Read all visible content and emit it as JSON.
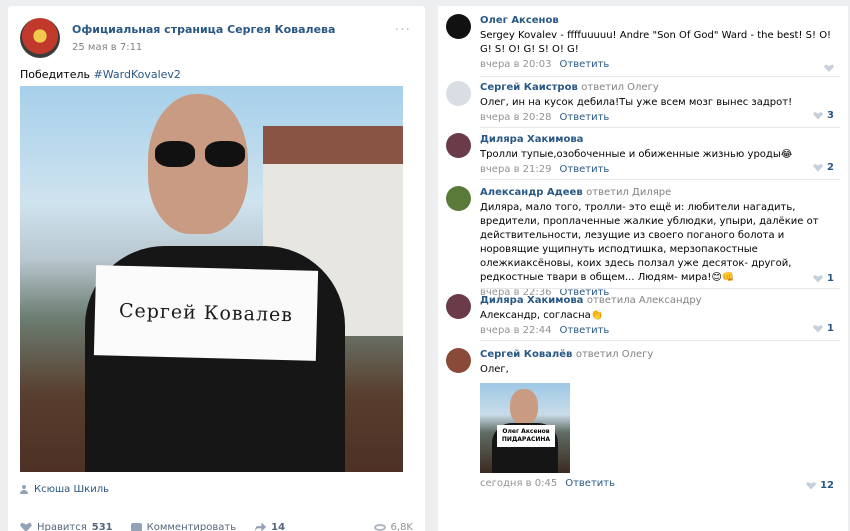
{
  "post": {
    "page_name": "Официальная страница Сергея Ковалева",
    "date": "25 мая в 7:11",
    "text_prefix": "Победитель ",
    "hashtag": "#WardKovalev2",
    "photo_sign": "Сергей Ковалев",
    "author": "Ксюша Шкиль",
    "actions": {
      "like_label": "Нравится",
      "like_count": "531",
      "comment_label": "Комментировать",
      "share_count": "14",
      "views": "6,8K"
    }
  },
  "comments": [
    {
      "author": "Олег Аксенов",
      "reply_to": "",
      "text": "Sergey Kovalev - ffffuuuuu! Andre \"Son Of God\" Ward - the best! S! O! G! S! O! G! S! O! G!",
      "time": "вчера в 20:03",
      "reply_label": "Ответить",
      "likes": "",
      "avatar_color": "#111111"
    },
    {
      "author": "Сергей Каистров",
      "reply_to": "ответил Олегу",
      "text": "Олег, ин на кусок дебила!Ты уже всем мозг вынес задрот!",
      "time": "вчера в 20:28",
      "reply_label": "Ответить",
      "likes": "3",
      "avatar_color": "#d9dee5"
    },
    {
      "author": "Диляра Хакимова",
      "reply_to": "",
      "text": "Тролли тупые,озобоченные и обиженные жизнью уроды😂",
      "time": "вчера в 21:29",
      "reply_label": "Ответить",
      "likes": "2",
      "avatar_color": "#6b3b4a"
    },
    {
      "author": "Александр Адеев",
      "reply_to": "ответил Диляре",
      "text": "Диляра, мало того, тролли- это ещё и: любители нагадить, вредители, проплаченные жалкие ублюдки, упыри, далёкие от действительности, лезущие из своего поганого болота и норовящие ущипнуть исподтишка, мерзопакостные олежкиаксёновы, коих здесь ползал уже десяток- другой, редкостные твари в общем... Людям- мира!😊👊",
      "time": "вчера в 22:36",
      "reply_label": "Ответить",
      "likes": "1",
      "avatar_color": "#5a7a3a"
    },
    {
      "author": "Диляра Хакимова",
      "reply_to": "ответила Александру",
      "text": "Александр, согласна👏",
      "time": "вчера в 22:44",
      "reply_label": "Ответить",
      "likes": "1",
      "avatar_color": "#6b3b4a"
    },
    {
      "author": "Сергей Ковалёв",
      "reply_to": "ответил Олегу",
      "text": "Олег,",
      "time": "сегодня в 0:45",
      "reply_label": "Ответить",
      "likes": "12",
      "avatar_color": "#8a4a3a",
      "attachment_sign_line1": "Олег Аксенов",
      "attachment_sign_line2": "ПИДАРАСИНА"
    }
  ]
}
